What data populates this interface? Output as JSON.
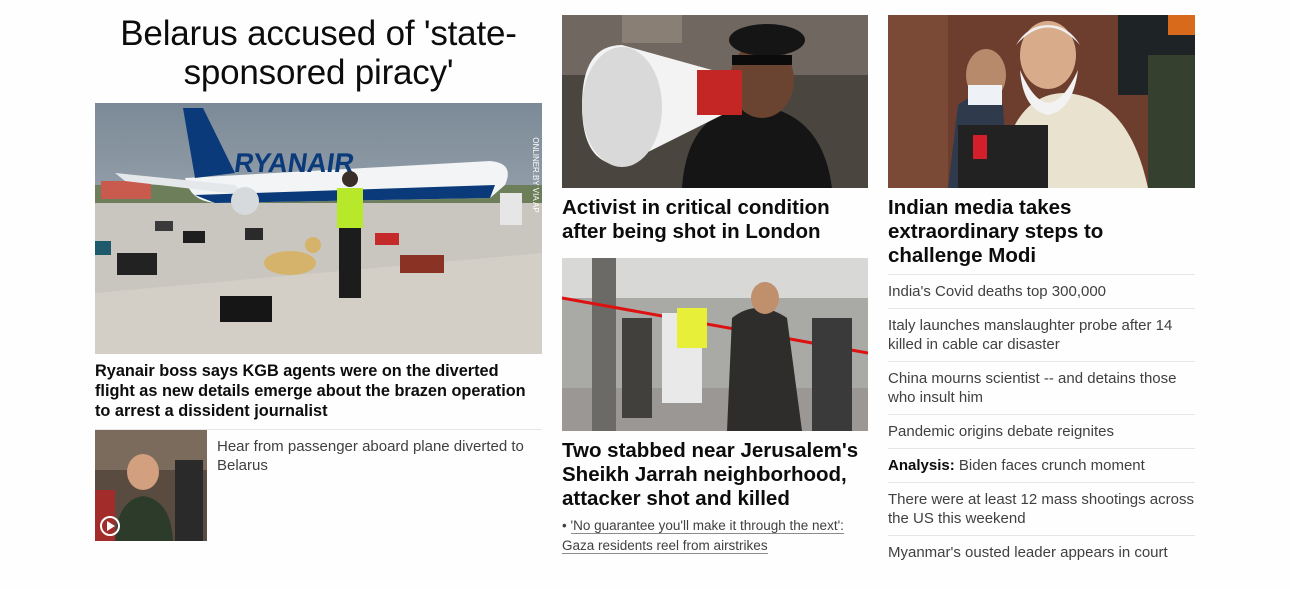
{
  "hero": {
    "title": "Belarus accused of 'state-sponsored piracy'",
    "image_credit": "ONLINER.BY VIA AP",
    "plane_livery": "RYANAIR",
    "summary": "Ryanair boss says KGB agents were on the diverted flight as new details emerge about the brazen operation to arrest a dissident journalist",
    "video_link": "Hear from passenger aboard plane diverted to Belarus"
  },
  "middle": {
    "story1": "Activist in critical condition after being shot in London",
    "story2": "Two stabbed near Jerusalem's Sheikh Jarrah neighborhood, attacker shot and killed",
    "related_bullet": "•",
    "related": "'No guarantee you'll make it through the next': Gaza residents reel from airstrikes"
  },
  "right": {
    "headline": "Indian media takes extraordinary steps to challenge Modi",
    "links": [
      {
        "prefix": "",
        "text": "India's Covid deaths top 300,000"
      },
      {
        "prefix": "",
        "text": "Italy launches manslaughter probe after 14 killed in cable car disaster"
      },
      {
        "prefix": "",
        "text": "China mourns scientist -- and detains those who insult him"
      },
      {
        "prefix": "",
        "text": "Pandemic origins debate reignites"
      },
      {
        "prefix": "Analysis:",
        "text": "Biden faces crunch moment"
      },
      {
        "prefix": "",
        "text": "There were at least 12 mass shootings across the US this weekend"
      },
      {
        "prefix": "",
        "text": "Myanmar's ousted leader appears in court"
      }
    ]
  },
  "icons": {
    "video": "play-icon"
  }
}
